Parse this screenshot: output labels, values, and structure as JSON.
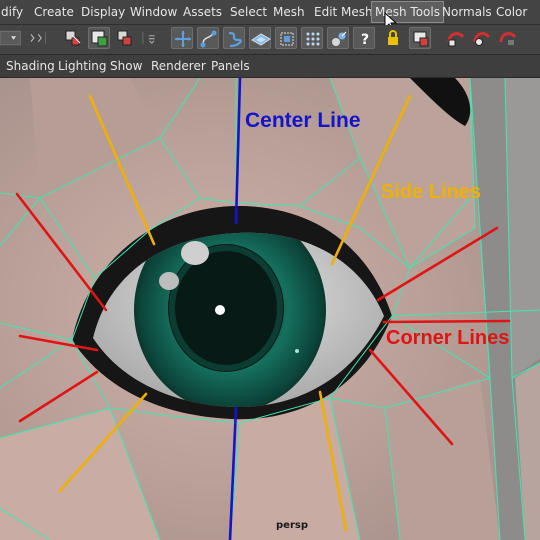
{
  "menubar": {
    "items": [
      "dify",
      "Create",
      "Display",
      "Window",
      "Assets",
      "Select",
      "Mesh",
      "Edit Mesh",
      "Mesh Tools",
      "Normals",
      "Color"
    ],
    "active": "Mesh Tools"
  },
  "toolbar": {
    "icons": [
      "mode-dropdown-icon",
      "separator-arrows-icon",
      "select-hierarchy-icon",
      "select-object-icon",
      "select-component-icon",
      "snap-divider-icon",
      "snap-grid-icon",
      "snap-curve-icon",
      "snap-point-icon",
      "snap-view-plane-icon",
      "snap-live-surface-icon",
      "make-live-icon",
      "history-icon",
      "help-icon",
      "lock-icon",
      "render-view-icon",
      "render-current-icon",
      "ipr-render-icon",
      "render-settings-icon"
    ]
  },
  "panel_menu": {
    "items": [
      "Shading",
      "Lighting",
      "Show",
      "Renderer",
      "Panels"
    ]
  },
  "viewport": {
    "camera": "persp",
    "annotations": {
      "center": "Center Line",
      "side": "Side Lines",
      "corner": "Corner Lines"
    },
    "colors": {
      "center": "#1414c8",
      "side": "#f0b000",
      "corner": "#e01414",
      "wireframe": "#3de8b0",
      "skin": "#c2a49b",
      "iris": "#0f5c4d",
      "eye_socket": "#151515"
    }
  }
}
